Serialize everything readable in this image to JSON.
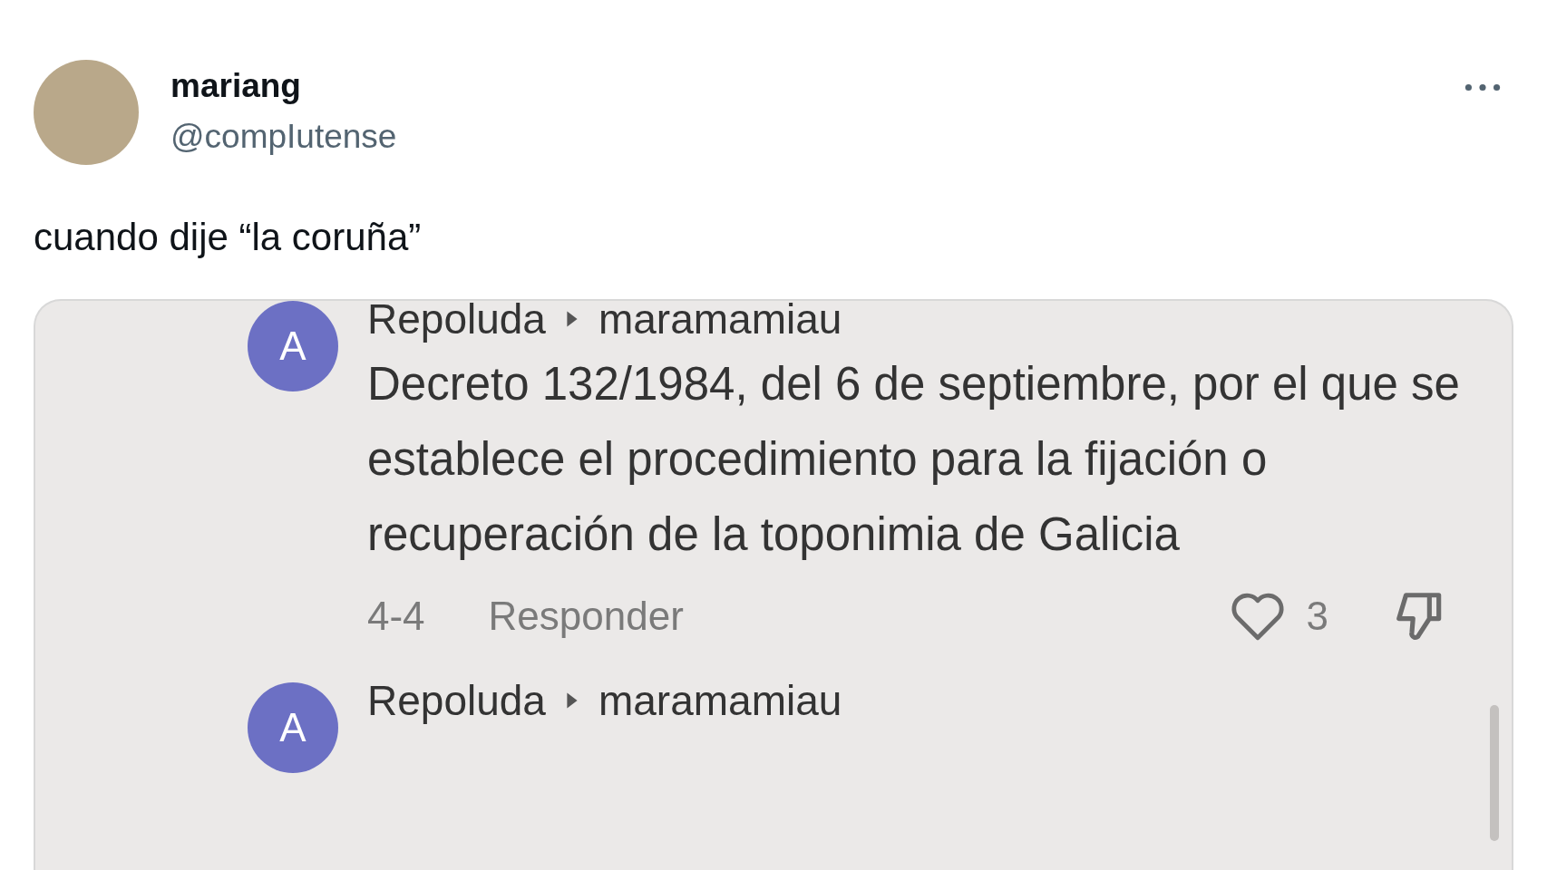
{
  "tweet": {
    "author": {
      "name": "mariang",
      "handle": "@compIutense"
    },
    "text": "cuando dije “la coruña”"
  },
  "embedded_screenshot": {
    "comments": [
      {
        "avatar_letter": "A",
        "author": "Repoluda",
        "reply_to": "maramamiau",
        "text": "Decreto 132/1984, del 6 de septiembre, por el que se establece el procedimiento para la fijación o recuperación de la toponimia de Galicia",
        "date": "4-4",
        "reply_label": "Responder",
        "likes": "3",
        "liked": false
      },
      {
        "avatar_letter": "A",
        "author": "Repoluda",
        "reply_to": "maramamiau"
      }
    ]
  }
}
